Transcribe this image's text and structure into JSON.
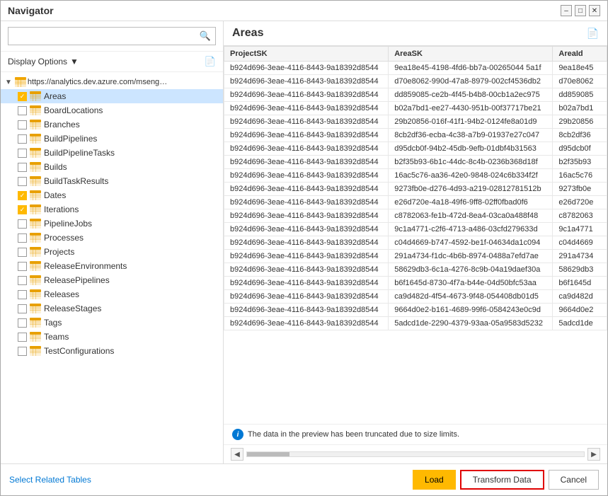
{
  "window": {
    "title": "Navigator"
  },
  "search": {
    "placeholder": ""
  },
  "display_options": {
    "label": "Display Options"
  },
  "tree": {
    "root_url": "https://analytics.dev.azure.com/mseng/Azu...",
    "items": [
      {
        "id": "Areas",
        "label": "Areas",
        "checked": true,
        "selected": true
      },
      {
        "id": "BoardLocations",
        "label": "BoardLocations",
        "checked": false,
        "selected": false
      },
      {
        "id": "Branches",
        "label": "Branches",
        "checked": false,
        "selected": false
      },
      {
        "id": "BuildPipelines",
        "label": "BuildPipelines",
        "checked": false,
        "selected": false
      },
      {
        "id": "BuildPipelineTasks",
        "label": "BuildPipelineTasks",
        "checked": false,
        "selected": false
      },
      {
        "id": "Builds",
        "label": "Builds",
        "checked": false,
        "selected": false
      },
      {
        "id": "BuildTaskResults",
        "label": "BuildTaskResults",
        "checked": false,
        "selected": false
      },
      {
        "id": "Dates",
        "label": "Dates",
        "checked": true,
        "selected": false
      },
      {
        "id": "Iterations",
        "label": "Iterations",
        "checked": true,
        "selected": false
      },
      {
        "id": "PipelineJobs",
        "label": "PipelineJobs",
        "checked": false,
        "selected": false
      },
      {
        "id": "Processes",
        "label": "Processes",
        "checked": false,
        "selected": false
      },
      {
        "id": "Projects",
        "label": "Projects",
        "checked": false,
        "selected": false
      },
      {
        "id": "ReleaseEnvironments",
        "label": "ReleaseEnvironments",
        "checked": false,
        "selected": false
      },
      {
        "id": "ReleasePipelines",
        "label": "ReleasePipelines",
        "checked": false,
        "selected": false
      },
      {
        "id": "Releases",
        "label": "Releases",
        "checked": false,
        "selected": false
      },
      {
        "id": "ReleaseStages",
        "label": "ReleaseStages",
        "checked": false,
        "selected": false
      },
      {
        "id": "Tags",
        "label": "Tags",
        "checked": false,
        "selected": false
      },
      {
        "id": "Teams",
        "label": "Teams",
        "checked": false,
        "selected": false
      },
      {
        "id": "TestConfigurations",
        "label": "TestConfigurations",
        "checked": false,
        "selected": false
      }
    ]
  },
  "right_panel": {
    "title": "Areas",
    "columns": [
      "ProjectSK",
      "AreaSK",
      "AreaId"
    ],
    "rows": [
      [
        "b924d696-3eae-4116-8443-9a18392d8544",
        "9ea18e45-4198-4fd6-bb7a-00265044 5a1f",
        "9ea18e45"
      ],
      [
        "b924d696-3eae-4116-8443-9a18392d8544",
        "d70e8062-990d-47a8-8979-002cf4536db2",
        "d70e8062"
      ],
      [
        "b924d696-3eae-4116-8443-9a18392d8544",
        "dd859085-ce2b-4f45-b4b8-00cb1a2ec975",
        "dd859085"
      ],
      [
        "b924d696-3eae-4116-8443-9a18392d8544",
        "b02a7bd1-ee27-4430-951b-00f37717be21",
        "b02a7bd1"
      ],
      [
        "b924d696-3eae-4116-8443-9a18392d8544",
        "29b20856-016f-41f1-94b2-0124fe8a01d9",
        "29b20856"
      ],
      [
        "b924d696-3eae-4116-8443-9a18392d8544",
        "8cb2df36-ecba-4c38-a7b9-01937e27c047",
        "8cb2df36"
      ],
      [
        "b924d696-3eae-4116-8443-9a18392d8544",
        "d95dcb0f-94b2-45db-9efb-01dbf4b31563",
        "d95dcb0f"
      ],
      [
        "b924d696-3eae-4116-8443-9a18392d8544",
        "b2f35b93-6b1c-44dc-8c4b-0236b368d18f",
        "b2f35b93"
      ],
      [
        "b924d696-3eae-4116-8443-9a18392d8544",
        "16ac5c76-aa36-42e0-9848-024c6b334f2f",
        "16ac5c76"
      ],
      [
        "b924d696-3eae-4116-8443-9a18392d8544",
        "9273fb0e-d276-4d93-a219-02812781512b",
        "9273fb0e"
      ],
      [
        "b924d696-3eae-4116-8443-9a18392d8544",
        "e26d720e-4a18-49f6-9ff8-02ff0fbad0f6",
        "e26d720e"
      ],
      [
        "b924d696-3eae-4116-8443-9a18392d8544",
        "c8782063-fe1b-472d-8ea4-03ca0a488f48",
        "c8782063"
      ],
      [
        "b924d696-3eae-4116-8443-9a18392d8544",
        "9c1a4771-c2f6-4713-a486-03cfd279633d",
        "9c1a4771"
      ],
      [
        "b924d696-3eae-4116-8443-9a18392d8544",
        "c04d4669-b747-4592-be1f-04634da1c094",
        "c04d4669"
      ],
      [
        "b924d696-3eae-4116-8443-9a18392d8544",
        "291a4734-f1dc-4b6b-8974-0488a7efd7ae",
        "291a4734"
      ],
      [
        "b924d696-3eae-4116-8443-9a18392d8544",
        "58629db3-6c1a-4276-8c9b-04a19daef30a",
        "58629db3"
      ],
      [
        "b924d696-3eae-4116-8443-9a18392d8544",
        "b6f1645d-8730-4f7a-b44e-04d50bfc53aa",
        "b6f1645d"
      ],
      [
        "b924d696-3eae-4116-8443-9a18392d8544",
        "ca9d482d-4f54-4673-9f48-054408db01d5",
        "ca9d482d"
      ],
      [
        "b924d696-3eae-4116-8443-9a18392d8544",
        "9664d0e2-b161-4689-99f6-0584243e0c9d",
        "9664d0e2"
      ],
      [
        "b924d696-3eae-4116-8443-9a18392d8544",
        "5adcd1de-2290-4379-93aa-05a9583d5232",
        "5adcd1de"
      ]
    ],
    "truncation_notice": "The data in the preview has been truncated due to size limits."
  },
  "bottom": {
    "select_related_label": "Select Related Tables",
    "load_label": "Load",
    "transform_label": "Transform Data",
    "cancel_label": "Cancel"
  }
}
